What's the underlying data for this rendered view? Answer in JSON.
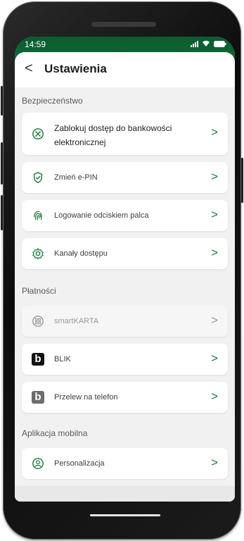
{
  "status": {
    "time": "14:59"
  },
  "header": {
    "back": "<",
    "title": "Ustawienia"
  },
  "sections": {
    "security": "Bezpieczeństwo",
    "payments": "Płatności",
    "app": "Aplikacja mobilna"
  },
  "items": {
    "block_access": "Zablokuj dostęp do bankowości elektronicznej",
    "change_pin": "Zmień e-PIN",
    "fingerprint": "Logowanie odciskiem palca",
    "channels": "Kanały dostępu",
    "smartkarta": "smartKARTA",
    "blik": "BLIK",
    "transfer_phone": "Przelew na telefon",
    "personalization": "Personalizacja"
  },
  "colors": {
    "accent": "#1f7a3f",
    "topbar": "#0b5c2f"
  }
}
